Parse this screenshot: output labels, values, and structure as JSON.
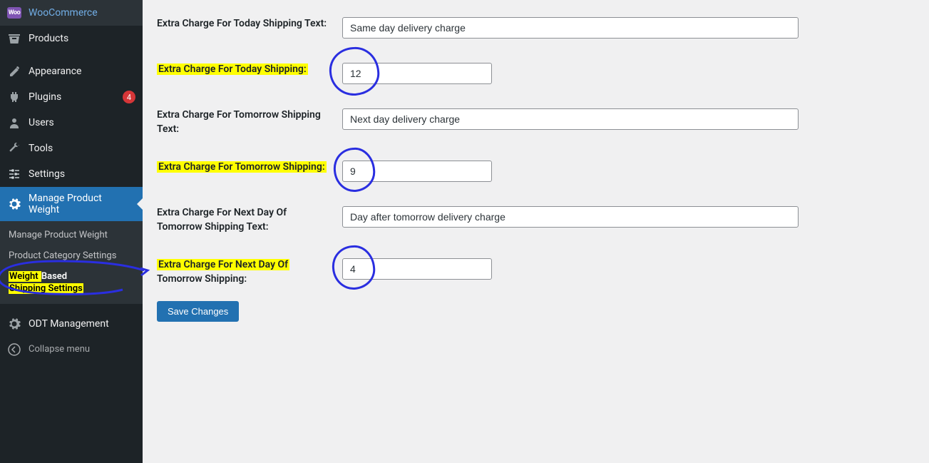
{
  "sidebar": {
    "woocommerce": "WooCommerce",
    "products": "Products",
    "appearance": "Appearance",
    "plugins": "Plugins",
    "plugins_badge": "4",
    "users": "Users",
    "tools": "Tools",
    "settings": "Settings",
    "manage_weight": "Manage Product Weight",
    "submenu": {
      "manage_weight": "Manage Product Weight",
      "category_settings": "Product Category Settings",
      "weight_based_pre": "Weight ",
      "weight_based_hl1": "Based",
      "weight_based_br": " ",
      "weight_based_hl2": "Shipping Settings"
    },
    "odt": "ODT Management",
    "collapse": "Collapse menu"
  },
  "form": {
    "today_text_label": "Extra Charge For Today Shipping Text:",
    "today_text_value": "Same day delivery charge",
    "today_label": "Extra Charge For Today Shipping:",
    "today_value": "12",
    "tomorrow_text_label": "Extra Charge For Tomorrow Shipping Text:",
    "tomorrow_text_value": "Next day delivery charge",
    "tomorrow_label": "Extra Charge For Tomorrow Shipping:",
    "tomorrow_value": "9",
    "dayafter_text_label": "Extra Charge For Next Day Of Tomorrow Shipping Text:",
    "dayafter_text_value": "Day after tomorrow delivery charge",
    "dayafter_label_pre": "Extra Charge For Next Day Of",
    "dayafter_label_post": " Tomorrow Shipping:",
    "dayafter_value": "4",
    "save": "Save Changes"
  }
}
